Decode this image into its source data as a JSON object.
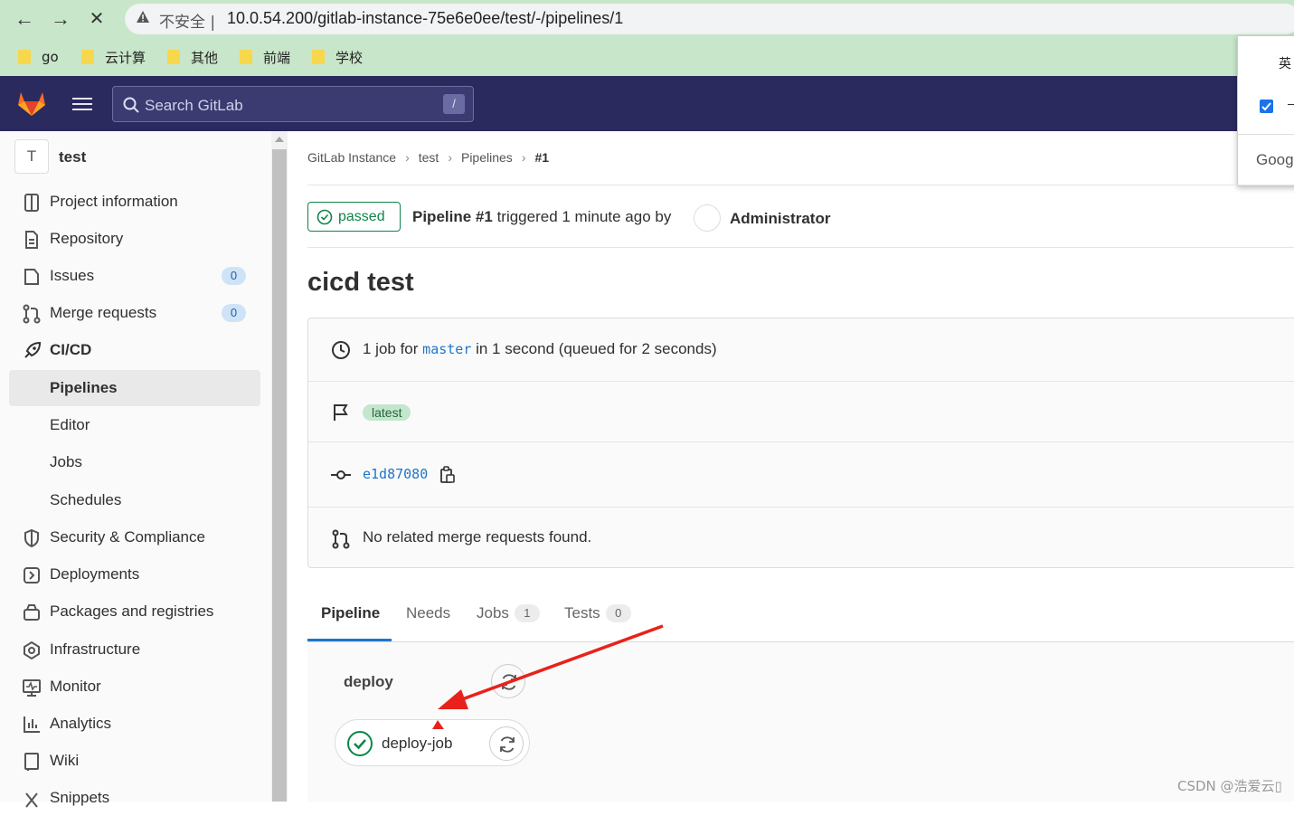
{
  "browser": {
    "back": "←",
    "forward": "→",
    "stop": "✕",
    "warning_icon": "warning-triangle-icon",
    "insecure_label": "不安全 |",
    "url": "10.0.54.200/gitlab-instance-75e6e0ee/test/-/pipelines/1",
    "bookmarks": [
      "go",
      "云计算",
      "其他",
      "前端",
      "学校"
    ],
    "bar_color": "#c8e6c9"
  },
  "popup": {
    "top_text": "英",
    "dash": "–",
    "google_text": "Googl"
  },
  "topnav": {
    "search_placeholder": "Search GitLab",
    "search_shortcut": "/",
    "bg_color": "#2a2a5e"
  },
  "sidebar": {
    "project_initial": "T",
    "project_name": "test",
    "items": [
      {
        "label": "Project information",
        "icon": "project-icon"
      },
      {
        "label": "Repository",
        "icon": "doc-icon"
      },
      {
        "label": "Issues",
        "icon": "issues-icon",
        "count": "0"
      },
      {
        "label": "Merge requests",
        "icon": "merge-request-icon",
        "count": "0"
      },
      {
        "label": "CI/CD",
        "icon": "rocket-icon"
      },
      {
        "label": "Pipelines"
      },
      {
        "label": "Editor"
      },
      {
        "label": "Jobs"
      },
      {
        "label": "Schedules"
      },
      {
        "label": "Security & Compliance",
        "icon": "shield-icon"
      },
      {
        "label": "Deployments",
        "icon": "deployments-icon"
      },
      {
        "label": "Packages and registries",
        "icon": "package-icon"
      },
      {
        "label": "Infrastructure",
        "icon": "infrastructure-icon"
      },
      {
        "label": "Monitor",
        "icon": "monitor-icon"
      },
      {
        "label": "Analytics",
        "icon": "analytics-icon"
      },
      {
        "label": "Wiki",
        "icon": "wiki-icon"
      },
      {
        "label": "Snippets",
        "icon": "snippet-icon"
      }
    ]
  },
  "breadcrumb": [
    "GitLab Instance",
    "test",
    "Pipelines",
    "#1"
  ],
  "pipeline": {
    "status": "passed",
    "status_color": "#108548",
    "name": "Pipeline #1",
    "triggered_text": "triggered 1 minute ago by",
    "author": "Administrator",
    "title": "cicd test",
    "summary_prefix": "1 job for",
    "branch": "master",
    "summary_suffix": "in 1 second (queued for 2 seconds)",
    "tag": "latest",
    "commit": "e1d87080",
    "merge_text": "No related merge requests found."
  },
  "tabs": [
    {
      "label": "Pipeline"
    },
    {
      "label": "Needs"
    },
    {
      "label": "Jobs",
      "count": "1"
    },
    {
      "label": "Tests",
      "count": "0"
    }
  ],
  "graph": {
    "stage": "deploy",
    "job": "deploy-job"
  },
  "watermark": "CSDN @浩爱云▯"
}
